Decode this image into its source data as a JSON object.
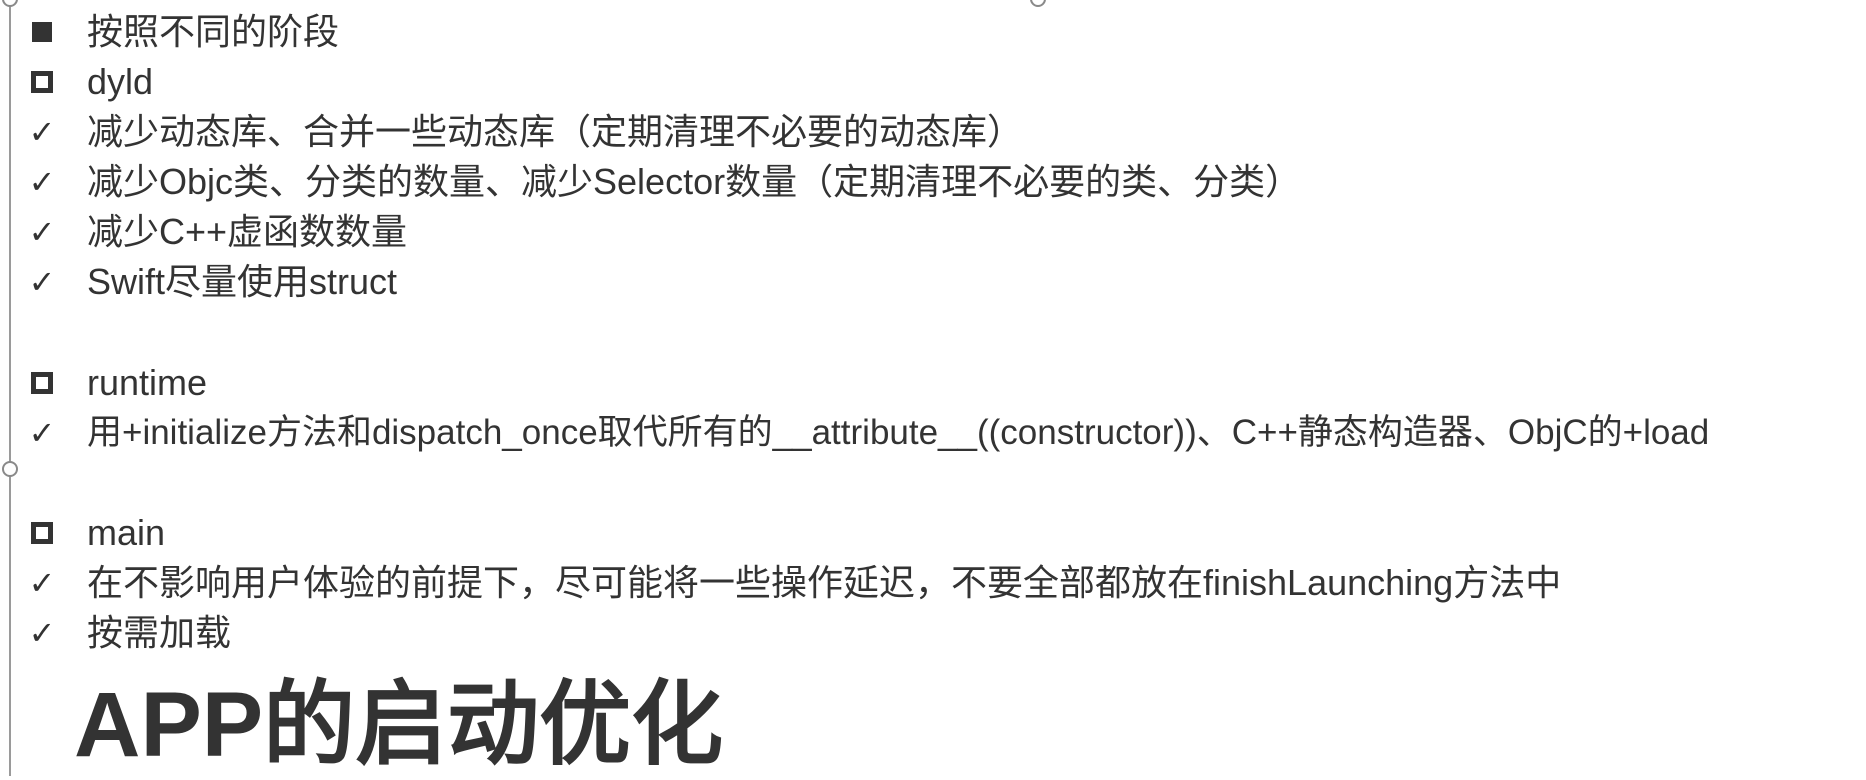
{
  "items": [
    {
      "marker": "filled-square-bullet-icon",
      "text": "按照不同的阶段"
    },
    {
      "marker": "hollow-square-bullet-icon",
      "text": "dyld"
    },
    {
      "marker": "check-icon",
      "text": "减少动态库、合并一些动态库（定期清理不必要的动态库）"
    },
    {
      "marker": "check-icon",
      "text": "减少Objc类、分类的数量、减少Selector数量（定期清理不必要的类、分类）"
    },
    {
      "marker": "check-icon",
      "text": "减少C++虚函数数量"
    },
    {
      "marker": "check-icon",
      "text": "Swift尽量使用struct"
    },
    {
      "marker": "hollow-square-bullet-icon",
      "text": "runtime"
    },
    {
      "marker": "check-icon",
      "text": "用+initialize方法和dispatch_once取代所有的__attribute__((constructor))、C++静态构造器、ObjC的+load"
    },
    {
      "marker": "hollow-square-bullet-icon",
      "text": "main"
    },
    {
      "marker": "check-icon",
      "text": "在不影响用户体验的前提下，尽可能将一些操作延迟，不要全部都放在finishLaunching方法中"
    },
    {
      "marker": "check-icon",
      "text": "按需加载"
    }
  ],
  "title": "APP的启动优化",
  "colors": {
    "text": "#333333",
    "edge": "#9a9a9a",
    "background": "#ffffff"
  }
}
